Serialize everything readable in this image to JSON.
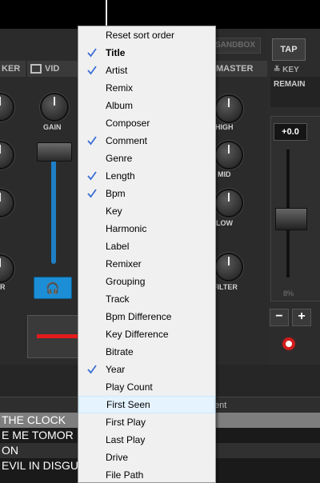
{
  "deck": {
    "sandbox_label": "SANDBOX",
    "headers": {
      "left": "KER",
      "video": "VID",
      "master": "MASTER"
    },
    "knobs": {
      "gain": "GAIN",
      "high": "HIGH",
      "mid": "MID",
      "low": "LOW",
      "filter": "FILTER",
      "left_cut": "R"
    },
    "tap_label": "TAP",
    "key_label": "KEY",
    "remain_label": "REMAIN",
    "pitch_value": "+0.0",
    "pitch_percent": "8%",
    "minus_label": "−",
    "plus_label": "+",
    "headphone_icon": "headphones-icon"
  },
  "browser": {
    "column_header_fragment": "ent",
    "rows": [
      "THE CLOCK",
      "E ME TOMOR",
      "ON",
      "EVIL IN DISGU"
    ]
  },
  "menu": {
    "check_color": "#3c6fd6",
    "hover_color": "#e5f3ff",
    "items": [
      {
        "label": "Reset sort order",
        "checked": false,
        "bold": false,
        "hover": false
      },
      {
        "label": "Title",
        "checked": true,
        "bold": true,
        "hover": false
      },
      {
        "label": "Artist",
        "checked": true,
        "bold": false,
        "hover": false
      },
      {
        "label": "Remix",
        "checked": false,
        "bold": false,
        "hover": false
      },
      {
        "label": "Album",
        "checked": false,
        "bold": false,
        "hover": false
      },
      {
        "label": "Composer",
        "checked": false,
        "bold": false,
        "hover": false
      },
      {
        "label": "Comment",
        "checked": true,
        "bold": false,
        "hover": false
      },
      {
        "label": "Genre",
        "checked": false,
        "bold": false,
        "hover": false
      },
      {
        "label": "Length",
        "checked": true,
        "bold": false,
        "hover": false
      },
      {
        "label": "Bpm",
        "checked": true,
        "bold": false,
        "hover": false
      },
      {
        "label": "Key",
        "checked": false,
        "bold": false,
        "hover": false
      },
      {
        "label": "Harmonic",
        "checked": false,
        "bold": false,
        "hover": false
      },
      {
        "label": "Label",
        "checked": false,
        "bold": false,
        "hover": false
      },
      {
        "label": "Remixer",
        "checked": false,
        "bold": false,
        "hover": false
      },
      {
        "label": "Grouping",
        "checked": false,
        "bold": false,
        "hover": false
      },
      {
        "label": "Track",
        "checked": false,
        "bold": false,
        "hover": false
      },
      {
        "label": "Bpm Difference",
        "checked": false,
        "bold": false,
        "hover": false
      },
      {
        "label": "Key Difference",
        "checked": false,
        "bold": false,
        "hover": false
      },
      {
        "label": "Bitrate",
        "checked": false,
        "bold": false,
        "hover": false
      },
      {
        "label": "Year",
        "checked": true,
        "bold": false,
        "hover": false
      },
      {
        "label": "Play Count",
        "checked": false,
        "bold": false,
        "hover": false
      },
      {
        "label": "First Seen",
        "checked": false,
        "bold": false,
        "hover": true
      },
      {
        "label": "First Play",
        "checked": false,
        "bold": false,
        "hover": false
      },
      {
        "label": "Last Play",
        "checked": false,
        "bold": false,
        "hover": false
      },
      {
        "label": "Drive",
        "checked": false,
        "bold": false,
        "hover": false
      },
      {
        "label": "File Path",
        "checked": false,
        "bold": false,
        "hover": false
      }
    ]
  }
}
